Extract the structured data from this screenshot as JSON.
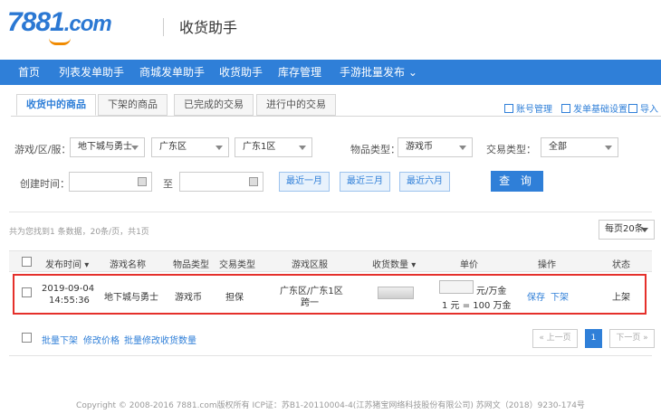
{
  "brand": {
    "logo_text": "7881",
    "logo_suffix": ".com",
    "subtitle": "收货助手"
  },
  "nav": [
    "首页",
    "列表发单助手",
    "商城发单助手",
    "收货助手",
    "库存管理",
    "手游批量发布"
  ],
  "tabs": [
    "收货中的商品",
    "下架的商品",
    "已完成的交易",
    "进行中的交易"
  ],
  "tools": [
    "账号管理",
    "发单基础设置",
    "导入"
  ],
  "filters": {
    "game_label": "游戏/区/服：",
    "game": "地下城与勇士",
    "region": "广东区",
    "server": "广东1区",
    "item_type_label": "物品类型：",
    "item_type": "游戏币",
    "trade_type_label": "交易类型：",
    "trade_type": "全部",
    "created_label": "创建时间：",
    "to_label": "至",
    "quick": [
      "最近一月",
      "最近三月",
      "最近六月"
    ],
    "search_label": "查 询"
  },
  "result_count": "共为您找到1 条数据，20条/页，共1页",
  "per_page": "每页20条",
  "table": {
    "headers": [
      "发布时间",
      "游戏名称",
      "物品类型",
      "交易类型",
      "游戏区服",
      "收货数量",
      "单价",
      "操作",
      "状态"
    ],
    "rows": [
      {
        "date": "2019-09-04",
        "time": "14:55:36",
        "game": "地下城与勇士",
        "item_type": "物品类型",
        "item_type_val": "游戏币",
        "trade_type": "担保",
        "server_line1": "广东区/广东1区",
        "server_line2": "跨一",
        "price_unit": "元/万金",
        "price_rate": "1 元 = 100 万金",
        "action_save": "保存",
        "action_off": "下架",
        "status": "上架"
      }
    ]
  },
  "bulk": [
    "批量下架",
    "修改价格",
    "批量修改收货数量"
  ],
  "pager": {
    "prev": "« 上一页",
    "page": "1",
    "next": "下一页 »"
  },
  "footer": "Copyright © 2008-2016 7881.com版权所有 ICP证：苏B1-20110004-4(江苏猪宝网络科技股份有限公司) 苏网文（2018）9230-174号"
}
